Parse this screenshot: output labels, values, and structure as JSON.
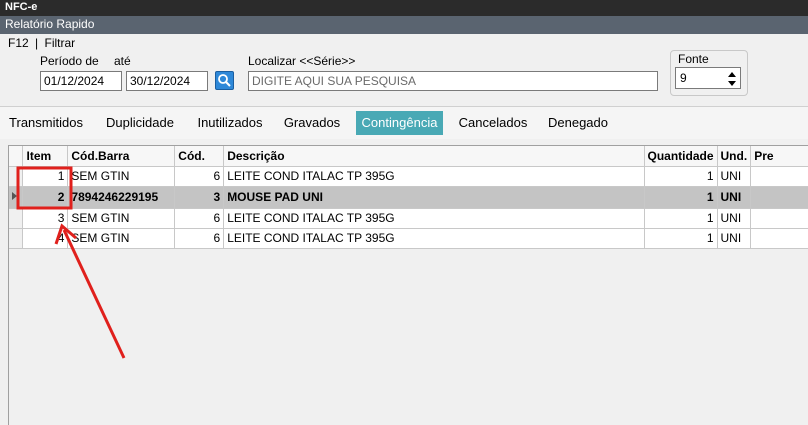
{
  "window": {
    "title": "NFC-e",
    "subtitle": "Relatório Rapido"
  },
  "filter": {
    "f12_label": "F12",
    "filter_label": "Filtrar",
    "period_label": "Período de",
    "until_label": "até",
    "date_from": "01/12/2024",
    "date_to": "30/12/2024",
    "search_label": "Localizar <<Série>>",
    "search_placeholder": "DIGITE AQUI SUA PESQUISA",
    "font_label": "Fonte",
    "font_value": "9"
  },
  "tabs": [
    {
      "label": "Transmitidos"
    },
    {
      "label": "Duplicidade"
    },
    {
      "label": "Inutilizados"
    },
    {
      "label": "Gravados"
    },
    {
      "label": "Contingência"
    },
    {
      "label": "Cancelados"
    },
    {
      "label": "Denegado"
    }
  ],
  "active_tab": "Contingência",
  "table": {
    "headers": {
      "item": "Item",
      "barcode": "Cód.Barra",
      "code": "Cód.",
      "desc": "Descrição",
      "qty": "Quantidade",
      "unit": "Und.",
      "price": "Pre"
    },
    "rows": [
      {
        "item": "1",
        "barcode": "SEM GTIN",
        "code": "6",
        "desc": "LEITE COND ITALAC TP 395G",
        "qty": "1",
        "unit": "UNI",
        "price": ""
      },
      {
        "item": "2",
        "barcode": "7894246229195",
        "code": "3",
        "desc": "MOUSE PAD  UNI",
        "qty": "1",
        "unit": "UNI",
        "price": ""
      },
      {
        "item": "3",
        "barcode": "SEM GTIN",
        "code": "6",
        "desc": "LEITE COND ITALAC TP 395G",
        "qty": "1",
        "unit": "UNI",
        "price": ""
      },
      {
        "item": "4",
        "barcode": "SEM GTIN",
        "code": "6",
        "desc": "LEITE COND ITALAC TP 395G",
        "qty": "1",
        "unit": "UNI",
        "price": ""
      }
    ]
  },
  "icons": {
    "search": "magnifier-icon",
    "spin_up": "arrow-up-icon",
    "spin_down": "arrow-down-icon"
  },
  "colors": {
    "active_tab": "#49a9b5",
    "selected_row": "#c4c4c4",
    "annotation": "#e0201c",
    "titlebar": "#2b2b2b"
  }
}
